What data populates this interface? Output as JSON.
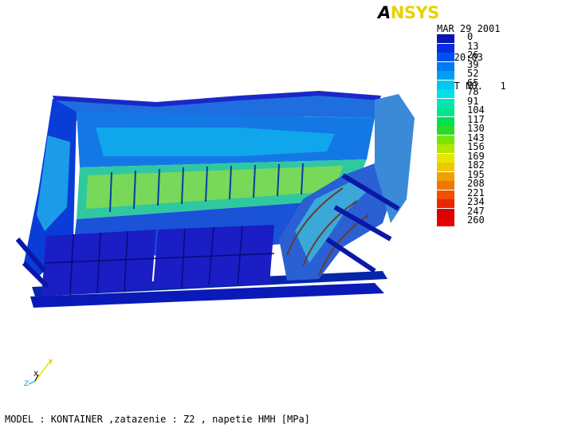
{
  "header": {
    "logo_a": "A",
    "logo_rest": "NSYS",
    "date": "MAR 29 2001",
    "time": "11:20:03",
    "plot_label": "PLOT NO.   1"
  },
  "legend": {
    "entries": [
      {
        "label": "0",
        "color": "#0a14b4"
      },
      {
        "label": "13",
        "color": "#0a2ce0"
      },
      {
        "label": "26",
        "color": "#0050f0"
      },
      {
        "label": "39",
        "color": "#0078f0"
      },
      {
        "label": "52",
        "color": "#00a0f0"
      },
      {
        "label": "65",
        "color": "#00c8f0"
      },
      {
        "label": "78",
        "color": "#00e0e6"
      },
      {
        "label": "91",
        "color": "#00e6b4"
      },
      {
        "label": "104",
        "color": "#00e68c"
      },
      {
        "label": "117",
        "color": "#00e050"
      },
      {
        "label": "130",
        "color": "#28dc28"
      },
      {
        "label": "143",
        "color": "#78e600"
      },
      {
        "label": "156",
        "color": "#b4e600"
      },
      {
        "label": "169",
        "color": "#e6e600"
      },
      {
        "label": "182",
        "color": "#f0c800"
      },
      {
        "label": "195",
        "color": "#f0a000"
      },
      {
        "label": "208",
        "color": "#f07800"
      },
      {
        "label": "221",
        "color": "#f05000"
      },
      {
        "label": "234",
        "color": "#e62800"
      },
      {
        "label": "247",
        "color": "#dc0000"
      },
      {
        "label": "260",
        "color": "#e60000"
      }
    ]
  },
  "axis": {
    "x": "X",
    "y": "Y",
    "z": "Z"
  },
  "footer": {
    "caption": "MODEL : KONTAINER ,zatazenie : Z2 , napetie HMH [MPa]"
  }
}
